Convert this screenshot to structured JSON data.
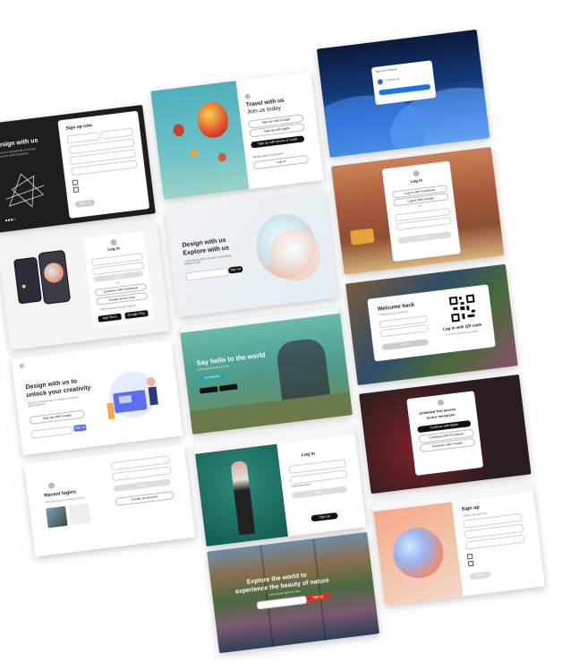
{
  "cards": {
    "design_dark": {
      "title": "Design with us",
      "subtitle": "Access to thousands of design resources and templates",
      "form_title": "Sign up now",
      "field_1": "First name",
      "field_2": "Last name",
      "field_3": "Email address",
      "field_4": "Phone number",
      "field_5": "Password",
      "button": "Sign up"
    },
    "travel": {
      "title_line1": "Travel with us",
      "title_line2": "Join us today",
      "btn_google": "Sign up with Google",
      "btn_apple": "Sign up with Apple",
      "btn_email": "Sign up with phone or email",
      "login_label": "Already have an account?",
      "login_button": "Log in"
    },
    "waves_modal": {
      "header": "Sign in to Account",
      "account": "Continue as"
    },
    "phones_login": {
      "title": "Log in",
      "or": "OR",
      "facebook": "Continue with Facebook",
      "signup": "Create an account",
      "question": "Don't have an account? Sign up",
      "app_store": "App Store",
      "google_play": "Google Play"
    },
    "explore_3d": {
      "title_line1": "Design with us",
      "title_line2": "Explore with us",
      "body": "Lorem ipsum dolor sit amet, consectetur adipiscing elit",
      "button": "Sign up"
    },
    "desert_login": {
      "title": "Log in",
      "btn_facebook": "Log in with Facebook",
      "btn_google": "Log in with Google",
      "or": "OR",
      "button": "Log in"
    },
    "unlock": {
      "title_line1": "Design with us to",
      "title_line2": "unlock your creativity",
      "subtitle": "Access to thousands of design resources and templates",
      "google": "Sign up with Google",
      "button": "Sign up"
    },
    "hello_world": {
      "title": "Say hello to the world",
      "subtitle": "Lorem ipsum dolor sit amet",
      "button": "Get started"
    },
    "welcome_back": {
      "title": "Welcome back",
      "subtitle": "Continue to your account",
      "qr_title": "Log in with QR code",
      "qr_sub": "Scan this code with your phone",
      "button": "Log in"
    },
    "recent_logins": {
      "title": "Recent logins",
      "subtitle": "Click your picture or add an account",
      "button": "Log in",
      "create": "Create an account"
    },
    "fashion_login": {
      "title": "Log in",
      "forgot": "Forgot password?",
      "button": "Log in",
      "signup": "Sign up"
    },
    "unlimited": {
      "title_line1": "Unlimited free access",
      "title_line2": "to our resources",
      "btn_apple": "Continue with Apple",
      "btn_facebook": "Continue with Facebook",
      "btn_google": "Continue with Google"
    },
    "explore_world": {
      "title_line1": "Explore the world to",
      "title_line2": "experience the beauty of nature",
      "subtitle": "Lorem ipsum dolor sit amet",
      "button": "Sign up"
    },
    "sphere_signup": {
      "title": "Sign up",
      "subtitle": "Create your account",
      "button": "Sign up"
    }
  }
}
